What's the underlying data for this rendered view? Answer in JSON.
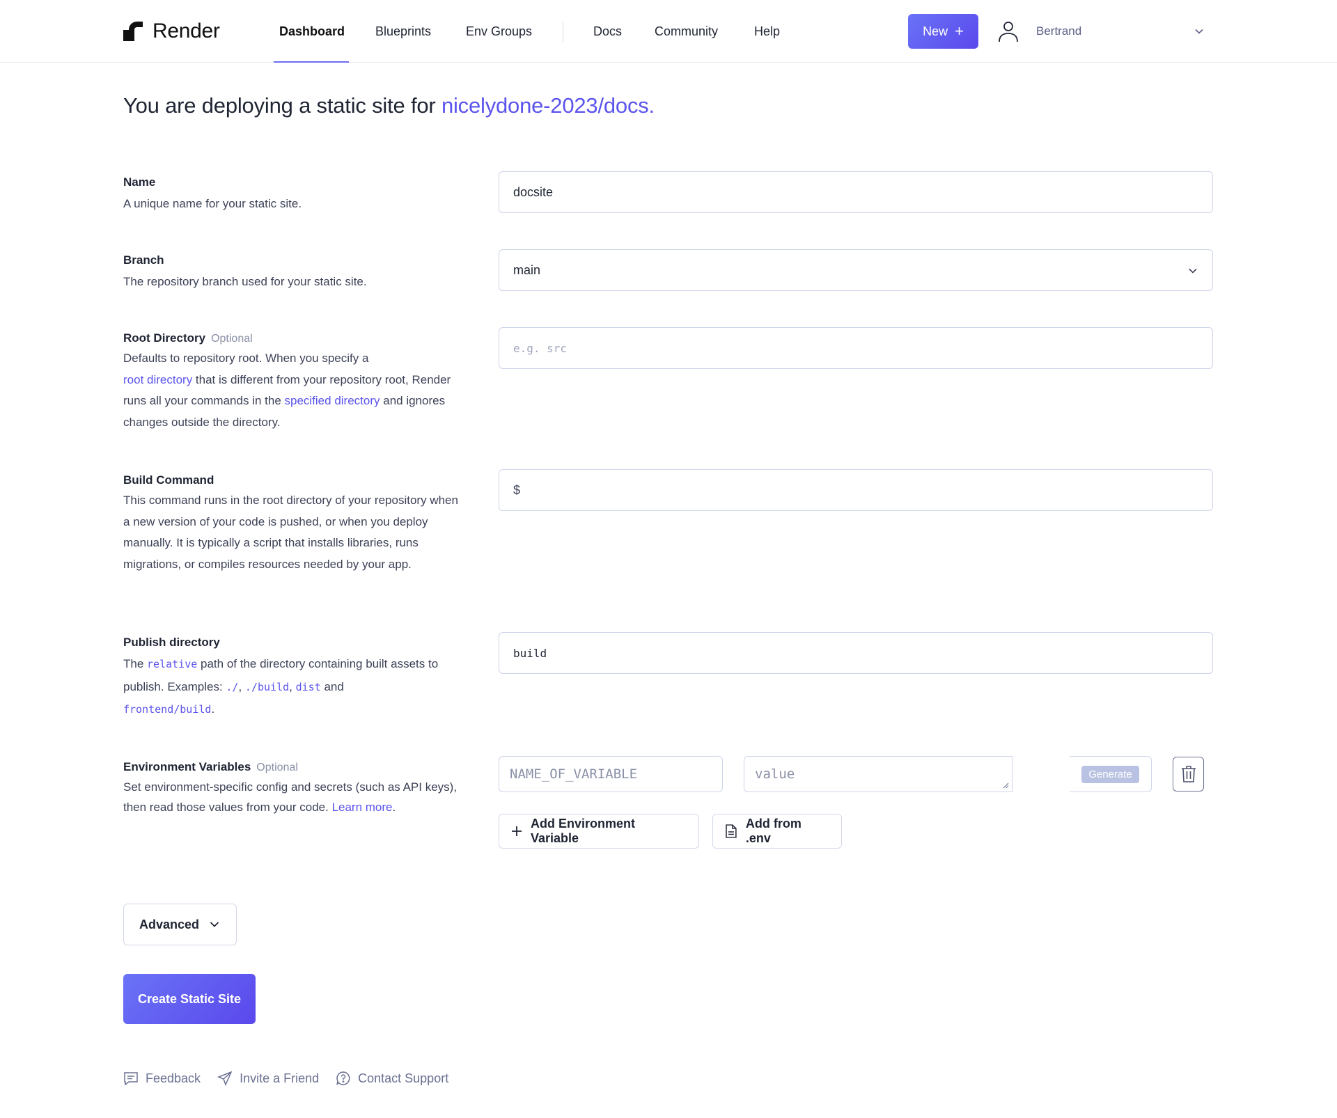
{
  "header": {
    "brand": "Render",
    "nav": [
      {
        "label": "Dashboard",
        "active": true
      },
      {
        "label": "Blueprints"
      },
      {
        "label": "Env Groups"
      },
      {
        "label": "Docs"
      },
      {
        "label": "Community"
      },
      {
        "label": "Help"
      }
    ],
    "new_button": "New",
    "user_name": "Bertrand",
    "accent": "#5b54ec"
  },
  "title": {
    "prefix": "You are deploying a static site for",
    "repo": "nicelydone-2023/docs."
  },
  "form": {
    "name": {
      "label": "Name",
      "description": "A unique name for your static site.",
      "value": "docsite"
    },
    "branch": {
      "label": "Branch",
      "description": "The repository branch used for your static site.",
      "value": "main"
    },
    "root_directory": {
      "label": "Root Directory",
      "optional": "Optional",
      "desc_1": "Defaults to repository root. When you specify a",
      "desc_link_1": "root directory",
      "desc_2": " that is different from your repository root, Render runs all your commands in the ",
      "desc_link_2": "specified directory",
      "desc_3": " and ignores changes outside the directory.",
      "placeholder": "e.g. src"
    },
    "build_command": {
      "label": "Build Command",
      "description": "This command runs in the root directory of your repository when a new version of your code is pushed, or when you deploy manually. It is typically a script that installs libraries, runs migrations, or compiles resources needed by your app.",
      "prompt": "$"
    },
    "publish_directory": {
      "label": "Publish directory",
      "desc_1": "The ",
      "code_relative": "relative",
      "desc_2": " path of the directory containing built assets to publish. Examples: ",
      "code_1": "./",
      "sep_1": ", ",
      "code_2": "./build",
      "sep_2": ", ",
      "code_3": "dist",
      "sep_3": " and ",
      "code_4": "frontend/build",
      "desc_end": ".",
      "value": "build"
    },
    "env_vars": {
      "label": "Environment Variables",
      "optional": "Optional",
      "desc_1": "Set environment-specific config and secrets (such as API keys), then read those values from your code. ",
      "desc_link": "Learn more",
      "desc_end": ".",
      "name_placeholder": "NAME_OF_VARIABLE",
      "value_placeholder": "value",
      "generate": "Generate",
      "add_button": "Add Environment Variable",
      "add_env_button": "Add from .env"
    }
  },
  "advanced": "Advanced",
  "create_button": "Create Static Site",
  "footer": {
    "feedback": "Feedback",
    "invite": "Invite a Friend",
    "support": "Contact Support"
  }
}
